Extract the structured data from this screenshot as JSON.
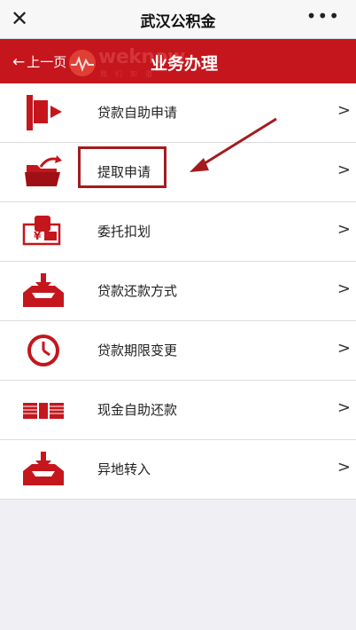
{
  "window": {
    "title": "武汉公积金",
    "close_icon": "close-icon",
    "more_icon": "more-icon"
  },
  "header": {
    "back_label": "上一页",
    "title": "业务办理",
    "watermark_text": "weknow",
    "watermark_sub": "我们知道"
  },
  "menu": [
    {
      "label": "贷款自助申请",
      "icon": "flag-icon",
      "chevron": ">"
    },
    {
      "label": "提取申请",
      "icon": "folder-withdraw-icon",
      "chevron": ">"
    },
    {
      "label": "委托扣划",
      "icon": "hand-yuan-icon",
      "chevron": ">"
    },
    {
      "label": "贷款还款方式",
      "icon": "tray-download-icon",
      "chevron": ">"
    },
    {
      "label": "贷款期限变更",
      "icon": "clock-icon",
      "chevron": ">"
    },
    {
      "label": "现金自助还款",
      "icon": "cash-stack-icon",
      "chevron": ">"
    },
    {
      "label": "异地转入",
      "icon": "tray-download-icon",
      "chevron": ">"
    }
  ],
  "colors": {
    "brand_red": "#c4161c",
    "annotation_red": "#a31b1f"
  }
}
